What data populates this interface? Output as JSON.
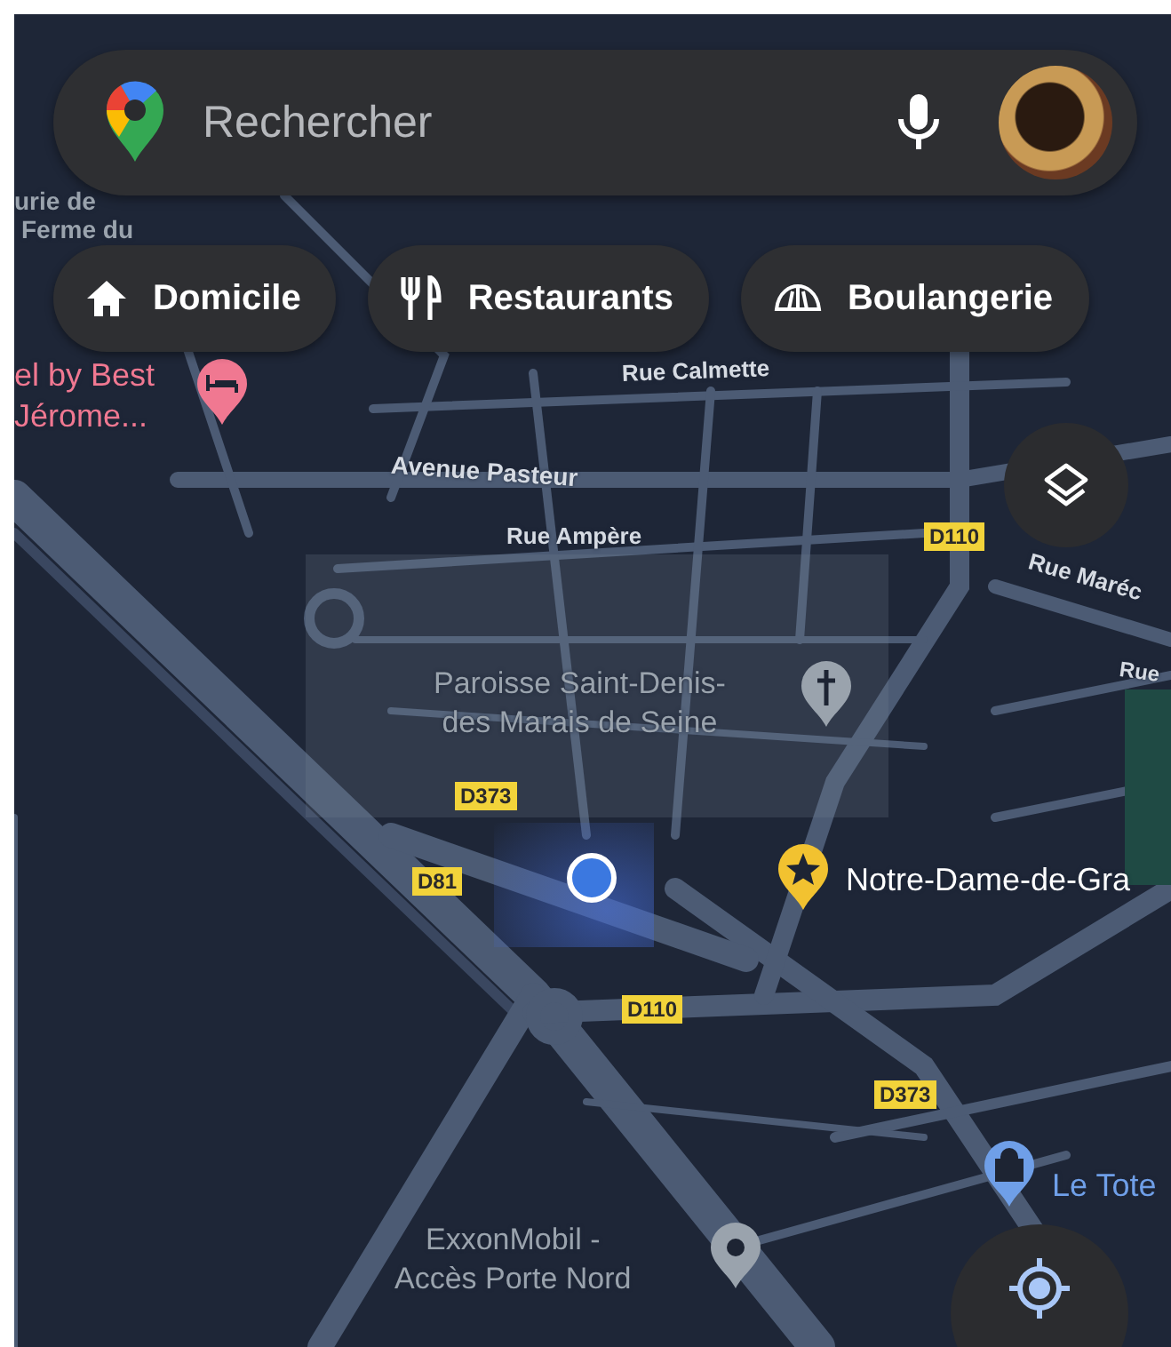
{
  "search": {
    "placeholder": "Rechercher"
  },
  "chips": [
    {
      "kind": "home",
      "label": "Domicile"
    },
    {
      "kind": "restaurant",
      "label": "Restaurants"
    },
    {
      "kind": "bakery",
      "label": "Boulangerie"
    }
  ],
  "map": {
    "streets": [
      "urie de",
      "Ferme du",
      "Rue Calmette",
      "Avenue Pasteur",
      "Rue Ampère",
      "Rue Maréc",
      "Rue"
    ],
    "road_shields": [
      "D110",
      "D373",
      "D81",
      "D110",
      "D373"
    ],
    "places": [
      {
        "kind": "hotel",
        "color": "#f07891",
        "lines": [
          "el by Best",
          "Jérome..."
        ]
      },
      {
        "kind": "church",
        "color": "#9aa3ad",
        "lines": [
          "Paroisse Saint-Denis-",
          "des Marais de Seine"
        ]
      },
      {
        "kind": "favorite",
        "color": "#f2c230",
        "lines": [
          "Notre-Dame-de-Gra"
        ]
      },
      {
        "kind": "shop",
        "color": "#6f9fe8",
        "lines": [
          "Le Tote"
        ]
      },
      {
        "kind": "fuel",
        "color": "#9aa3ad",
        "lines": [
          "ExxonMobil -",
          "Accès Porte Nord"
        ]
      }
    ]
  }
}
